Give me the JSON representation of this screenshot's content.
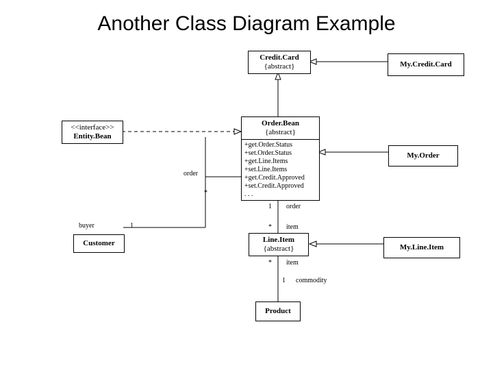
{
  "title": "Another Class Diagram Example",
  "boxes": {
    "creditcard": {
      "name": "Credit.Card",
      "stereo": "{abstract}"
    },
    "mycreditcard": {
      "name": "My.Credit.Card"
    },
    "entitybean": {
      "stereo": "<<interface>>",
      "name": "Entity.Bean"
    },
    "orderbean": {
      "name": "Order.Bean",
      "stereo": "{abstract}",
      "methods": [
        "+get.Order.Status",
        "+set.Order.Status",
        "+get.Line.Items",
        "+set.Line.Items",
        "+get.Credit.Approved",
        "+set.Credit.Approved",
        ". . ."
      ]
    },
    "myorder": {
      "name": "My.Order"
    },
    "customer": {
      "name": "Customer"
    },
    "lineitem": {
      "name": "Line.Item",
      "stereo": "{abstract}"
    },
    "mylineitem": {
      "name": "My.Line.Item"
    },
    "product": {
      "name": "Product"
    }
  },
  "labels": {
    "order_role_top": "order",
    "order_mult_star": "*",
    "order_one": "1",
    "order_text": "order",
    "item_star": "*",
    "item_text": "item",
    "buyer": "buyer",
    "buyer_one": "1",
    "item_star2": "*",
    "item_text2": "item",
    "commodity_one": "1",
    "commodity": "commodity"
  }
}
